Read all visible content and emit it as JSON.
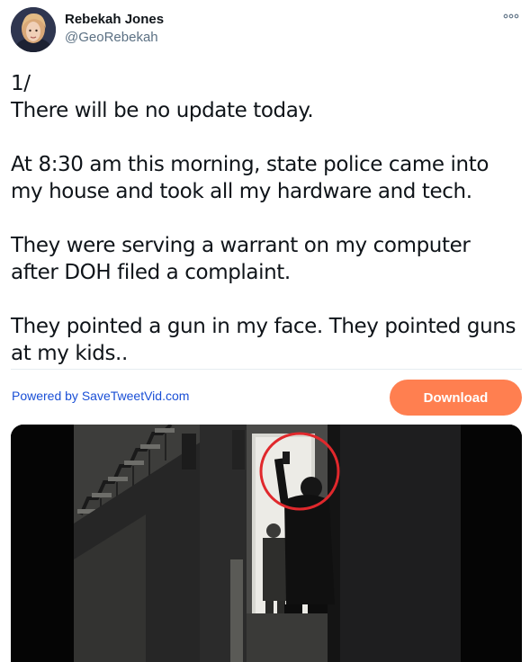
{
  "author": {
    "name": "Rebekah Jones",
    "handle": "@GeoRebekah",
    "avatar_icon": "profile-photo"
  },
  "more_icon": "ellipsis-icon",
  "tweet": {
    "paragraphs": [
      "1/\nThere will be no update today.",
      "At 8:30 am this morning, state police came into my house and took all my hardware and tech.",
      "They were serving a warrant on my computer after DOH filed a complaint.",
      "They pointed a gun in my face.  They pointed guns at my kids.."
    ]
  },
  "bar": {
    "powered_by": "Powered by SaveTweetVid.com",
    "download_label": "Download",
    "download_color": "#ff7f50"
  },
  "media": {
    "type": "video-still",
    "highlight_color": "#e0282c"
  }
}
